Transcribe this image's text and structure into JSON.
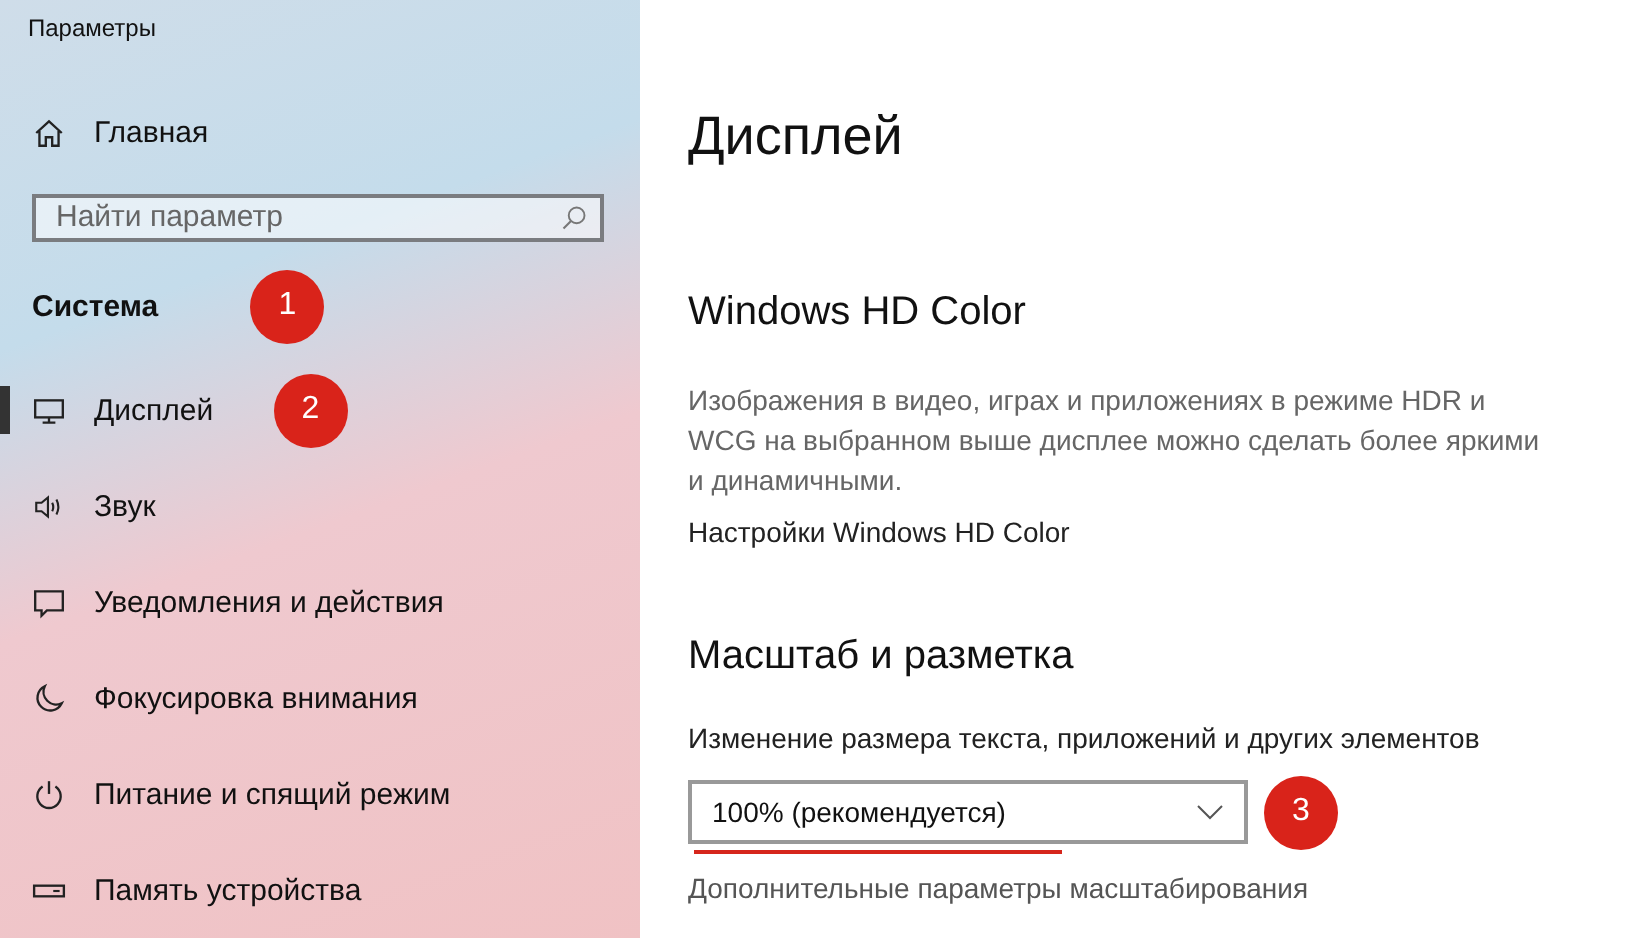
{
  "window": {
    "title": "Параметры"
  },
  "sidebar": {
    "home": {
      "label": "Главная"
    },
    "search": {
      "placeholder": "Найти параметр"
    },
    "section": {
      "label": "Система",
      "marker": "1"
    },
    "items": [
      {
        "label": "Дисплей",
        "selected": true,
        "marker": "2"
      },
      {
        "label": "Звук",
        "selected": false
      },
      {
        "label": "Уведомления и действия",
        "selected": false
      },
      {
        "label": "Фокусировка внимания",
        "selected": false
      },
      {
        "label": "Питание и спящий режим",
        "selected": false
      },
      {
        "label": "Память устройства",
        "selected": false
      }
    ]
  },
  "page": {
    "title": "Дисплей",
    "hd_color": {
      "heading": "Windows HD Color",
      "description": "Изображения в видео, играх и приложениях в режиме HDR и WCG на выбранном выше дисплее можно сделать более яркими и динамичными.",
      "link": "Настройки Windows HD Color"
    },
    "scale": {
      "heading": "Масштаб и разметка",
      "label": "Изменение размера текста, приложений и других элементов",
      "dropdown": {
        "value": "100% (рекомендуется)",
        "underlined": true,
        "marker": "3"
      },
      "link": "Дополнительные параметры масштабирования"
    }
  }
}
